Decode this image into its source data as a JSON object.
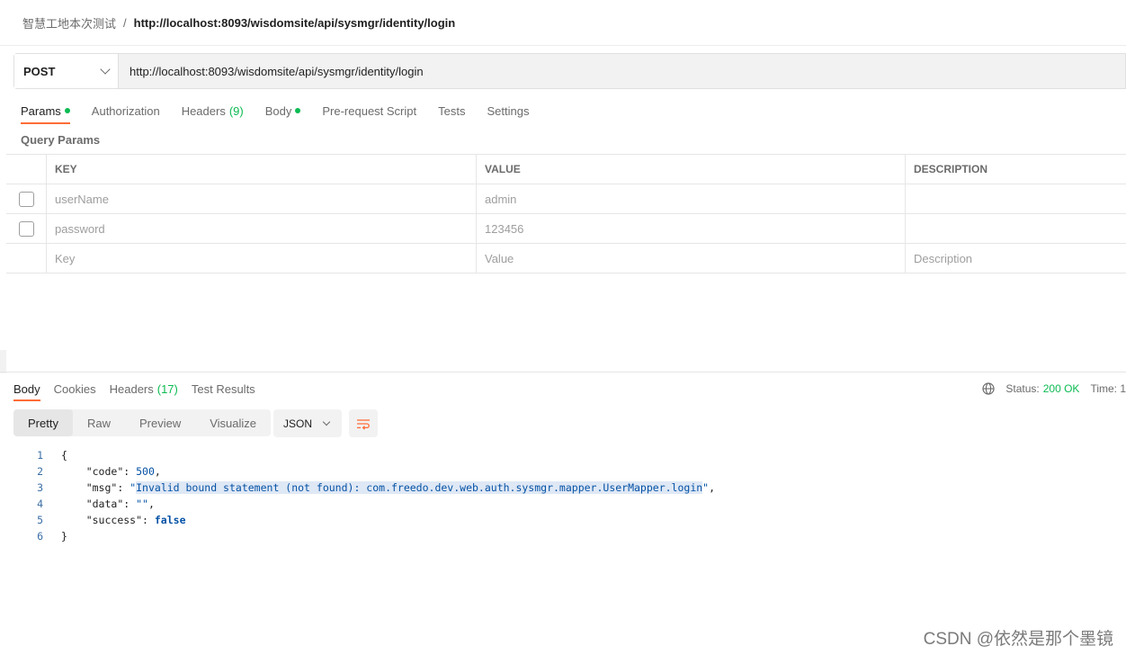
{
  "breadcrumb": {
    "parent": "智慧工地本次测试",
    "separator": "/",
    "current": "http://localhost:8093/wisdomsite/api/sysmgr/identity/login"
  },
  "request": {
    "method": "POST",
    "url": "http://localhost:8093/wisdomsite/api/sysmgr/identity/login"
  },
  "request_tabs": {
    "params": "Params",
    "authorization": "Authorization",
    "headers": "Headers",
    "headers_count": "(9)",
    "body": "Body",
    "prerequest": "Pre-request Script",
    "tests": "Tests",
    "settings": "Settings"
  },
  "query_params": {
    "title": "Query Params",
    "columns": [
      "KEY",
      "VALUE",
      "DESCRIPTION"
    ],
    "rows": [
      {
        "key": "userName",
        "value": "admin",
        "description": ""
      },
      {
        "key": "password",
        "value": "123456",
        "description": ""
      }
    ],
    "placeholder": {
      "key": "Key",
      "value": "Value",
      "description": "Description"
    }
  },
  "response_tabs": {
    "body": "Body",
    "cookies": "Cookies",
    "headers": "Headers",
    "headers_count": "(17)",
    "test_results": "Test Results"
  },
  "status": {
    "label": "Status:",
    "value": "200 OK",
    "time_label": "Time: 1"
  },
  "view_modes": [
    "Pretty",
    "Raw",
    "Preview",
    "Visualize"
  ],
  "format": "JSON",
  "code_lines": {
    "l1": "{",
    "code_key": "\"code\"",
    "code_val": "500",
    "msg_key": "\"msg\"",
    "msg_q1": "\"",
    "msg_val": "Invalid bound statement (not found): com.freedo.dev.web.auth.sysmgr.mapper.UserMapper.login",
    "msg_q2": "\"",
    "data_key": "\"data\"",
    "data_val": "\"\"",
    "success_key": "\"success\"",
    "success_val": "false",
    "l6": "}"
  },
  "line_numbers": [
    "1",
    "2",
    "3",
    "4",
    "5",
    "6"
  ],
  "watermark": "CSDN @依然是那个墨镜",
  "colors": {
    "accent": "#ff6c37",
    "success": "#0cbb52",
    "json_value": "#0451a5"
  }
}
